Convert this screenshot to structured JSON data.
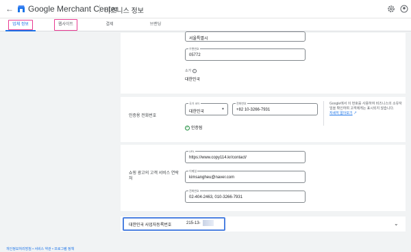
{
  "topbar": {
    "brand": "Google Merchant Center",
    "page_title": "비즈니스 정보"
  },
  "tabs": [
    {
      "label": "업체 정보"
    },
    {
      "label": "웹사이트"
    },
    {
      "label": "결제"
    },
    {
      "label": "브랜딩"
    }
  ],
  "address": {
    "city_value": "서울특별시",
    "postal_label": "우편번호",
    "postal_value": "05772",
    "country_label": "소가",
    "country_value": "대한민국"
  },
  "phone": {
    "section_label": "인증용 전화번호",
    "country_code_label": "국가 코드",
    "country_code_value": "대한민국",
    "phone_label": "전화번호",
    "phone_value": "+82 10-3266-7931",
    "verified_text": "인증됨",
    "help_text": "Google에서 이 번호를 사용하여 비즈니스의 소유자임을 확인하며 고객에게는 표시되지 않습니다.",
    "help_link": "자세히 알아보기"
  },
  "customer_service": {
    "section_label": "쇼핑 광고의 고객 서비스 연락처",
    "url_label": "URL",
    "url_value": "https://www.copy114.kr/contact/",
    "email_label": "이메일",
    "email_value": "kimsangheu@naver.com",
    "phone_label": "전화번호",
    "phone_value": "02-404-2463, 010-3266-7931"
  },
  "business_reg": {
    "label": "대한민국 사업자등록번호",
    "value": "215-13-"
  },
  "footer": {
    "links": "개인정보처리방침 • 서비스 약관 • 프로그램 정책"
  },
  "colors": {
    "accent": "#1a73e8",
    "highlight_pink": "#e8368f",
    "highlight_blue": "#4a7fe0",
    "verified_green": "#1e8e3e"
  }
}
